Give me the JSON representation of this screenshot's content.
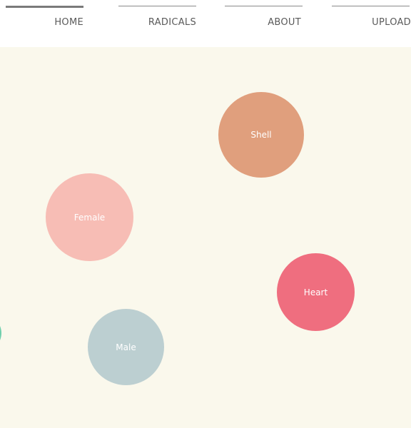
{
  "nav": {
    "items": [
      {
        "label": "HOME",
        "active": true
      },
      {
        "label": "RADICALS",
        "active": false
      },
      {
        "label": "ABOUT",
        "active": false
      },
      {
        "label": "UPLOAD",
        "active": false
      }
    ]
  },
  "bubbles": [
    {
      "label": "Shell",
      "color": "#e09f7d"
    },
    {
      "label": "Female",
      "color": "#f7bdb5"
    },
    {
      "label": "Heart",
      "color": "#ef6e7f"
    },
    {
      "label": "Male",
      "color": "#bccfd1"
    },
    {
      "label": "",
      "color": "#6fcfac"
    }
  ],
  "colors": {
    "background": "#faf8ec",
    "nav_background": "#ffffff",
    "nav_text": "#5a5a5a",
    "nav_line": "#8a8a8a"
  }
}
